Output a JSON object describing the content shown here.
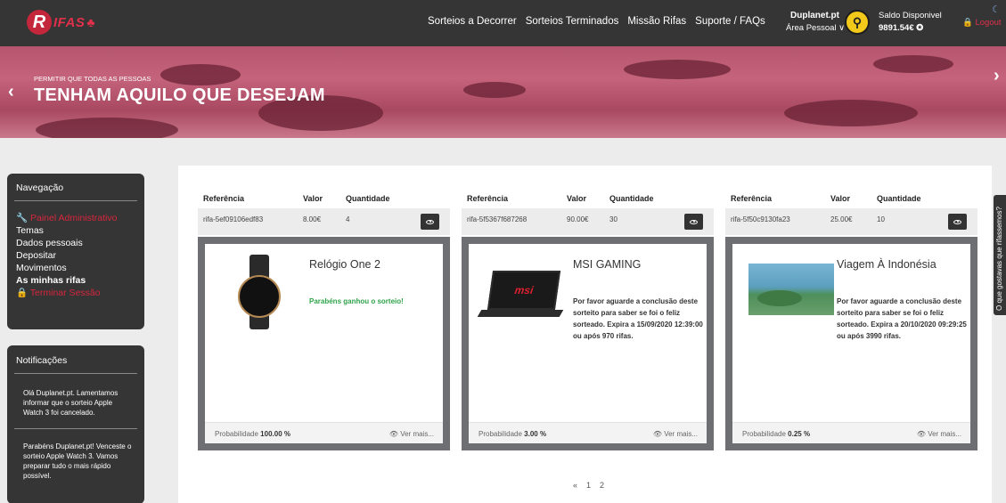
{
  "header": {
    "logo_text": "IFAS",
    "nav": [
      "Sorteios a Decorrer",
      "Sorteios Terminados",
      "Missão Rifas",
      "Suporte / FAQs"
    ],
    "user_name": "Duplanet.pt",
    "user_area": "Área Pessoal ∨",
    "balance_label": "Saldo Disponivel",
    "balance_value": "9891.54€ ✪",
    "logout": "🔒 Logout"
  },
  "hero": {
    "subtitle": "PERMITIR QUE TODAS AS PESSOAS",
    "title": "TENHAM AQUILO QUE DESEJAM"
  },
  "sidebar": {
    "nav_title": "Navegação",
    "items": [
      {
        "label": "🔧 Painel Administrativo",
        "red": true
      },
      {
        "label": "Temas"
      },
      {
        "label": "Dados pessoais"
      },
      {
        "label": "Depositar"
      },
      {
        "label": "Movimentos"
      },
      {
        "label": "As minhas rifas",
        "bold": true
      },
      {
        "label": "🔒 Terminar Sessão",
        "red": true
      }
    ],
    "notif_title": "Notificações",
    "notifications": [
      "Olá Duplanet.pt. Lamentamos informar que o sorteio Apple Watch 3 foi cancelado.",
      "Parabéns Duplanet.pt! Venceste o sorteio Apple Watch 3. Vamos preparar tudo o mais rápido possível."
    ]
  },
  "columns": {
    "ref": "Referência",
    "value": "Valor",
    "qty": "Quantidade"
  },
  "cards": [
    {
      "ref": "rifa-5ef09106edf83",
      "value": "8.00€",
      "qty": "4",
      "title": "Relógio One 2",
      "message": "Parabéns ganhou o sorteio!",
      "prob_label": "Probabilidade",
      "prob": "100.00 %",
      "more": "👁 Ver mais..."
    },
    {
      "ref": "rifa-5f5367f687268",
      "value": "90.00€",
      "qty": "30",
      "title": "MSI GAMING",
      "message": "Por favor aguarde a conclusão deste sorteito para saber se foi o feliz sorteado. Expira a 15/09/2020 12:39:00 ou após 970 rifas.",
      "prob_label": "Probabilidade",
      "prob": "3.00 %",
      "more": "👁 Ver mais..."
    },
    {
      "ref": "rifa-5f50c9130fa23",
      "value": "25.00€",
      "qty": "10",
      "title": "Viagem À Indonésia",
      "message": "Por favor aguarde a conclusão deste sorteito para saber se foi o feliz sorteado. Expira a 20/10/2020 09:29:25 ou após 3990 rifas.",
      "prob_label": "Probabilidade",
      "prob": "0.25 %",
      "more": "👁 Ver mais..."
    }
  ],
  "pagination": {
    "prev": "«",
    "pages": [
      "1",
      "2"
    ]
  },
  "side_tab": "O que gostavas que rifassemos?",
  "icons": {
    "prev_arrow": "chevron-left-icon",
    "next_arrow": "chevron-right-icon",
    "eye": "eye-icon"
  },
  "colors": {
    "brand": "#e0304a",
    "topbar": "#353535",
    "win": "#2fa34a"
  }
}
